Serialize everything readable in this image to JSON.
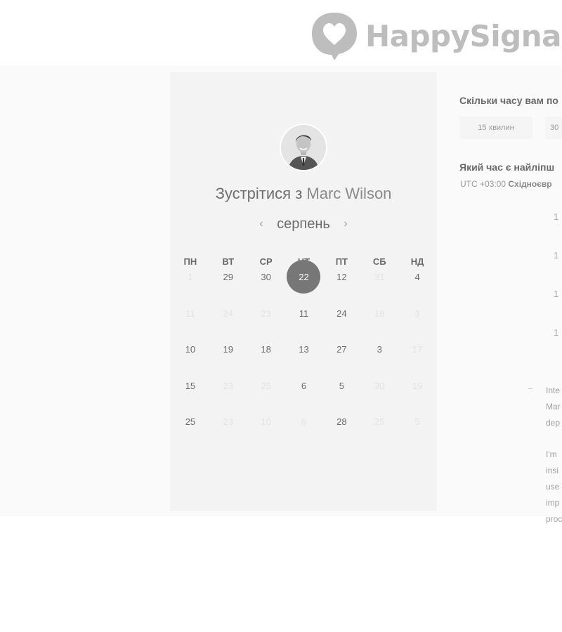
{
  "brand": {
    "name": "HappySignals"
  },
  "header": {
    "title_prefix": "Зустрітися з",
    "host_name": "Marc Wilson"
  },
  "calendar": {
    "month": "серпень",
    "weekdays": [
      "ПН",
      "ВТ",
      "СР",
      "ЧТ",
      "ПТ",
      "СБ",
      "НД"
    ],
    "rows": [
      [
        {
          "t": "1",
          "a": false
        },
        {
          "t": "29",
          "a": true
        },
        {
          "t": "30",
          "a": true
        },
        {
          "t": "22",
          "a": true,
          "sel": true
        },
        {
          "t": "12",
          "a": true
        },
        {
          "t": "31",
          "a": false
        },
        {
          "t": "4",
          "a": true
        }
      ],
      [
        {
          "t": "11",
          "a": false
        },
        {
          "t": "24",
          "a": false
        },
        {
          "t": "23",
          "a": false
        },
        {
          "t": "11",
          "a": true
        },
        {
          "t": "24",
          "a": true
        },
        {
          "t": "18",
          "a": false
        },
        {
          "t": "3",
          "a": false
        }
      ],
      [
        {
          "t": "10",
          "a": true
        },
        {
          "t": "19",
          "a": true
        },
        {
          "t": "18",
          "a": true
        },
        {
          "t": "13",
          "a": true
        },
        {
          "t": "27",
          "a": true
        },
        {
          "t": "3",
          "a": true
        },
        {
          "t": "17",
          "a": false
        }
      ],
      [
        {
          "t": "15",
          "a": true
        },
        {
          "t": "23",
          "a": false
        },
        {
          "t": "25",
          "a": false
        },
        {
          "t": "6",
          "a": true
        },
        {
          "t": "5",
          "a": true
        },
        {
          "t": "30",
          "a": false
        },
        {
          "t": "19",
          "a": false
        }
      ],
      [
        {
          "t": "25",
          "a": true
        },
        {
          "t": "23",
          "a": false
        },
        {
          "t": "10",
          "a": false
        },
        {
          "t": "6",
          "a": false
        },
        {
          "t": "28",
          "a": true
        },
        {
          "t": "25",
          "a": false
        },
        {
          "t": "5",
          "a": false
        }
      ]
    ]
  },
  "duration": {
    "question": "Скільки часу вам по",
    "options": [
      "15 хвилин",
      "30"
    ]
  },
  "time": {
    "question": "Який час є найліпш",
    "timezone_prefix": "UTC +03:00",
    "timezone_name": "Східноєвр",
    "slots": [
      "1",
      "1",
      "1",
      "1"
    ]
  },
  "bio": {
    "para1": [
      "Inte",
      "Mar",
      "dep"
    ],
    "para2": [
      "I'm",
      "insi",
      "use",
      "imp",
      "proc"
    ]
  },
  "colors": {
    "selected": "#777777",
    "panel": "#f3f3f3",
    "logo": "#bdbdbd"
  }
}
